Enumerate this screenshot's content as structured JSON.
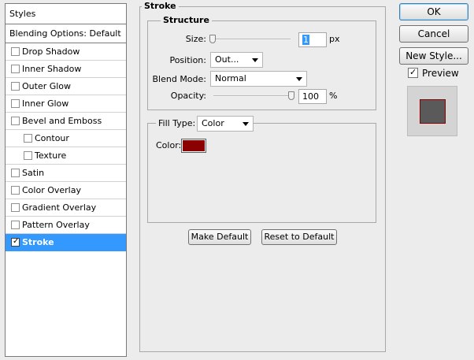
{
  "styles_panel": {
    "header": "Styles",
    "blending_options": "Blending Options: Default",
    "items": [
      {
        "label": "Drop Shadow",
        "checked": false
      },
      {
        "label": "Inner Shadow",
        "checked": false
      },
      {
        "label": "Outer Glow",
        "checked": false
      },
      {
        "label": "Inner Glow",
        "checked": false
      },
      {
        "label": "Bevel and Emboss",
        "checked": false
      },
      {
        "label": "Contour",
        "checked": false
      },
      {
        "label": "Texture",
        "checked": false
      },
      {
        "label": "Satin",
        "checked": false
      },
      {
        "label": "Color Overlay",
        "checked": false
      },
      {
        "label": "Gradient Overlay",
        "checked": false
      },
      {
        "label": "Pattern Overlay",
        "checked": false
      },
      {
        "label": "Stroke",
        "checked": true,
        "selected": true
      }
    ]
  },
  "stroke": {
    "title": "Stroke",
    "structure": {
      "title": "Structure",
      "size_label": "Size:",
      "size_value": "1",
      "size_unit": "px",
      "position_label": "Position:",
      "position_value": "Out...",
      "blend_mode_label": "Blend Mode:",
      "blend_mode_value": "Normal",
      "opacity_label": "Opacity:",
      "opacity_value": "100",
      "opacity_unit": "%",
      "size_slider_level": 0.0,
      "opacity_slider_level": 1.0
    },
    "fill_type_label": "Fill Type:",
    "fill_type_value": "Color",
    "color_label": "Color:",
    "color_value": "#8b0000",
    "make_default": "Make Default",
    "reset_default": "Reset to Default"
  },
  "actions": {
    "ok": "OK",
    "cancel": "Cancel",
    "new_style": "New Style...",
    "preview_label": "Preview",
    "preview_checked": true,
    "preview_swatch_color": "#5a5a5a",
    "preview_stroke_color": "#8b0000"
  },
  "icons": {
    "dropdown": "chevron-down-icon",
    "checkbox_checked": "checkmark-icon",
    "slider": "slider-thumb-icon"
  }
}
